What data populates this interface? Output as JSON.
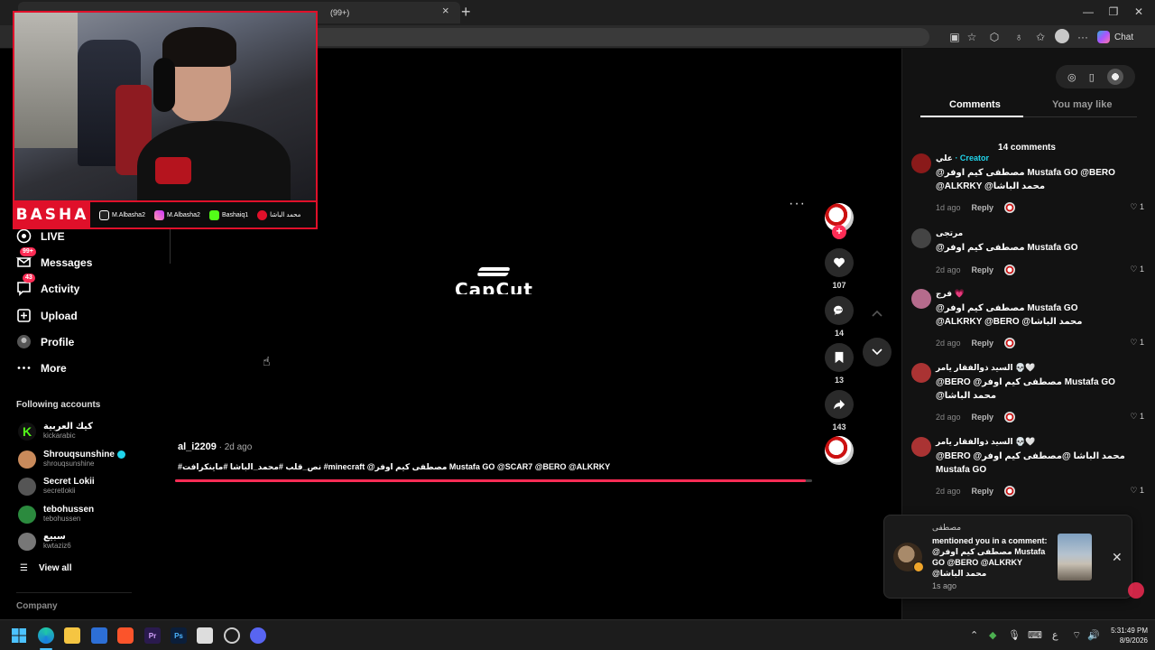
{
  "browser": {
    "tab_title": "(99+)",
    "tab_close": "×",
    "new_tab": "+",
    "window_controls": [
      "—",
      "❐",
      "✕"
    ],
    "chat_label": "Chat",
    "more": "···"
  },
  "nav": {
    "items": [
      {
        "label": "LIVE",
        "icon": "live-icon"
      },
      {
        "label": "Messages",
        "icon": "messages-icon",
        "badge": "99+"
      },
      {
        "label": "Activity",
        "icon": "activity-icon",
        "badge": "43"
      },
      {
        "label": "Upload",
        "icon": "upload-icon"
      },
      {
        "label": "Profile",
        "icon": "profile-icon"
      },
      {
        "label": "More",
        "icon": "more-icon"
      }
    ],
    "following_title": "Following accounts",
    "following": [
      {
        "name": "كيك العربية",
        "handle": "kickarabic",
        "color": "#53fc18"
      },
      {
        "name": "Shrouqsunshine",
        "handle": "shrouqsunshine",
        "color": "#c98a5b",
        "verified": true
      },
      {
        "name": "Secret Lokii",
        "handle": "secretlokii",
        "color": "#555"
      },
      {
        "name": "tebohussen",
        "handle": "tebohussen",
        "color": "#2b8a3e"
      },
      {
        "name": "سبيع",
        "handle": "kwtaziz6",
        "color": "#777"
      }
    ],
    "view_all": "View all",
    "company": "Company"
  },
  "webcam": {
    "brand": "BASHA",
    "socials": [
      "M.Albasha2",
      "M.Albasha2",
      "Bashaiq1",
      "محمد الباشا"
    ]
  },
  "video": {
    "watermark": "CapCut",
    "author": "al_i2209",
    "ago": " · 2d ago",
    "caption": "#نص_قلب #محمد_الباشا #ماينكرافت #minecraft @مصطفى كيم اوفر Mustafa GO @SCAR7 @BERO @ALKRKY",
    "progress": 0.99,
    "more": "···",
    "likes": "107",
    "comments": "14",
    "saves": "13",
    "shares": "143",
    "follow_plus": "+"
  },
  "comments_panel": {
    "tabs": [
      "Comments",
      "You may like"
    ],
    "count_title": "14 comments",
    "comments": [
      {
        "name": "علي",
        "creator": " · Creator",
        "text": "@مصطفى كيم اوفر Mustafa GO @BERO @ALKRKY @محمد الباشا",
        "ago": "1d ago",
        "likes": "1",
        "avatar": "#8a1a1a"
      },
      {
        "name": "مرتجى",
        "creator": "",
        "text": "@مصطفى كيم اوفر Mustafa GO",
        "ago": "2d ago",
        "likes": "1",
        "avatar": "#444"
      },
      {
        "name": "فرج 💗",
        "creator": "",
        "text": "@مصطفى كيم اوفر Mustafa GO @ALKRKY @BERO @محمد الباشا",
        "ago": "2d ago",
        "likes": "1",
        "avatar": "#b56b8c"
      },
      {
        "name": "السيد ذوالفقار يامر 💀🤍",
        "creator": "",
        "text": "@BERO @مصطفى كيم اوفر Mustafa GO @محمد الباشا",
        "ago": "2d ago",
        "likes": "1",
        "avatar": "#a33"
      },
      {
        "name": "السيد ذوالفقار يامر 💀🤍",
        "creator": "",
        "text": "@BERO @محمد الباشا @مصطفى كيم اوفر Mustafa GO",
        "ago": "2d ago",
        "likes": "1",
        "avatar": "#a33"
      }
    ],
    "reply_label": "Reply"
  },
  "toast": {
    "name": "مصطفى",
    "text": "mentioned you in a comment: @مصطفى كيم اوفر Mustafa GO @BERO @ALKRKY @محمد الباشا",
    "time": "1s ago",
    "close": "✕"
  },
  "taskbar": {
    "time": "5:31:49 PM",
    "date": "8/9/2026",
    "lang": "ع"
  }
}
